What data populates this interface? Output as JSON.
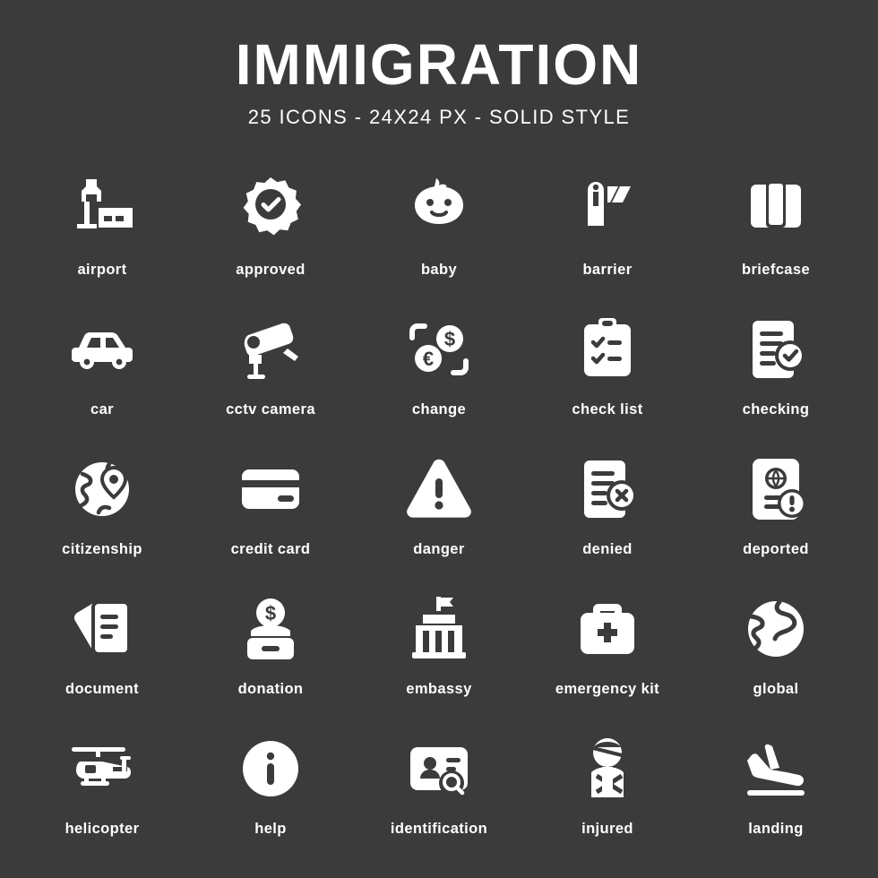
{
  "header": {
    "title": "IMMIGRATION",
    "subtitle": "25 ICONS - 24X24 PX - SOLID STYLE"
  },
  "theme": {
    "background": "#3b3b3b",
    "foreground": "#ffffff"
  },
  "icons": [
    {
      "name": "airport-icon",
      "label": "airport"
    },
    {
      "name": "approved-icon",
      "label": "approved"
    },
    {
      "name": "baby-icon",
      "label": "baby"
    },
    {
      "name": "barrier-icon",
      "label": "barrier"
    },
    {
      "name": "briefcase-icon",
      "label": "briefcase"
    },
    {
      "name": "car-icon",
      "label": "car"
    },
    {
      "name": "cctv-camera-icon",
      "label": "cctv camera"
    },
    {
      "name": "change-icon",
      "label": "change"
    },
    {
      "name": "check-list-icon",
      "label": "check list"
    },
    {
      "name": "checking-icon",
      "label": "checking"
    },
    {
      "name": "citizenship-icon",
      "label": "citizenship"
    },
    {
      "name": "credit-card-icon",
      "label": "credit card"
    },
    {
      "name": "danger-icon",
      "label": "danger"
    },
    {
      "name": "denied-icon",
      "label": "denied"
    },
    {
      "name": "deported-icon",
      "label": "deported"
    },
    {
      "name": "document-icon",
      "label": "document"
    },
    {
      "name": "donation-icon",
      "label": "donation"
    },
    {
      "name": "embassy-icon",
      "label": "embassy"
    },
    {
      "name": "emergency-kit-icon",
      "label": "emergency kit"
    },
    {
      "name": "global-icon",
      "label": "global"
    },
    {
      "name": "helicopter-icon",
      "label": "helicopter"
    },
    {
      "name": "help-icon",
      "label": "help"
    },
    {
      "name": "identification-icon",
      "label": "identification"
    },
    {
      "name": "injured-icon",
      "label": "injured"
    },
    {
      "name": "landing-icon",
      "label": "landing"
    }
  ]
}
